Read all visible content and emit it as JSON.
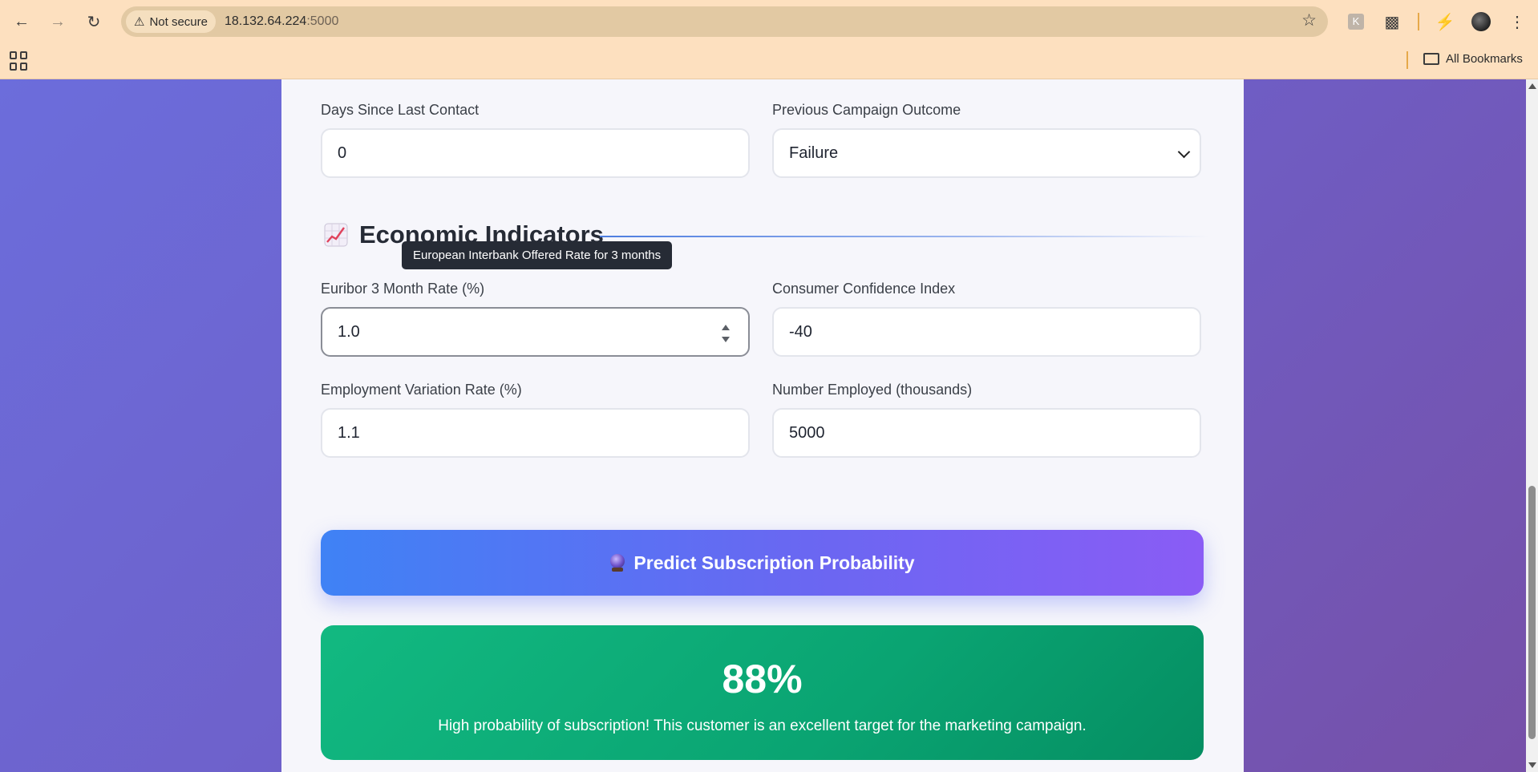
{
  "browser": {
    "security_label": "Not secure",
    "url_host": "18.132.64.224",
    "url_port": ":5000",
    "bookmarks_label": "All Bookmarks"
  },
  "form": {
    "days_since_contact": {
      "label": "Days Since Last Contact",
      "value": "0"
    },
    "previous_outcome": {
      "label": "Previous Campaign Outcome",
      "value": "Failure"
    },
    "section_title": "Economic Indicators",
    "section_icon": "chart-increasing-icon",
    "tooltip": "European Interbank Offered Rate for 3 months",
    "euribor": {
      "label": "Euribor 3 Month Rate (%)",
      "value": "1.0"
    },
    "consumer_confidence": {
      "label": "Consumer Confidence Index",
      "value": "-40"
    },
    "employment_variation": {
      "label": "Employment Variation Rate (%)",
      "value": "1.1"
    },
    "number_employed": {
      "label": "Number Employed (thousands)",
      "value": "5000"
    },
    "predict_button": "Predict Subscription Probability"
  },
  "result": {
    "percentage": "88%",
    "message": "High probability of subscription! This customer is an excellent target for the marketing campaign."
  },
  "colors": {
    "chrome": "#fde0bf",
    "button_start": "#3f82f5",
    "button_end": "#8a5cf5",
    "result_green": "#10b981"
  }
}
